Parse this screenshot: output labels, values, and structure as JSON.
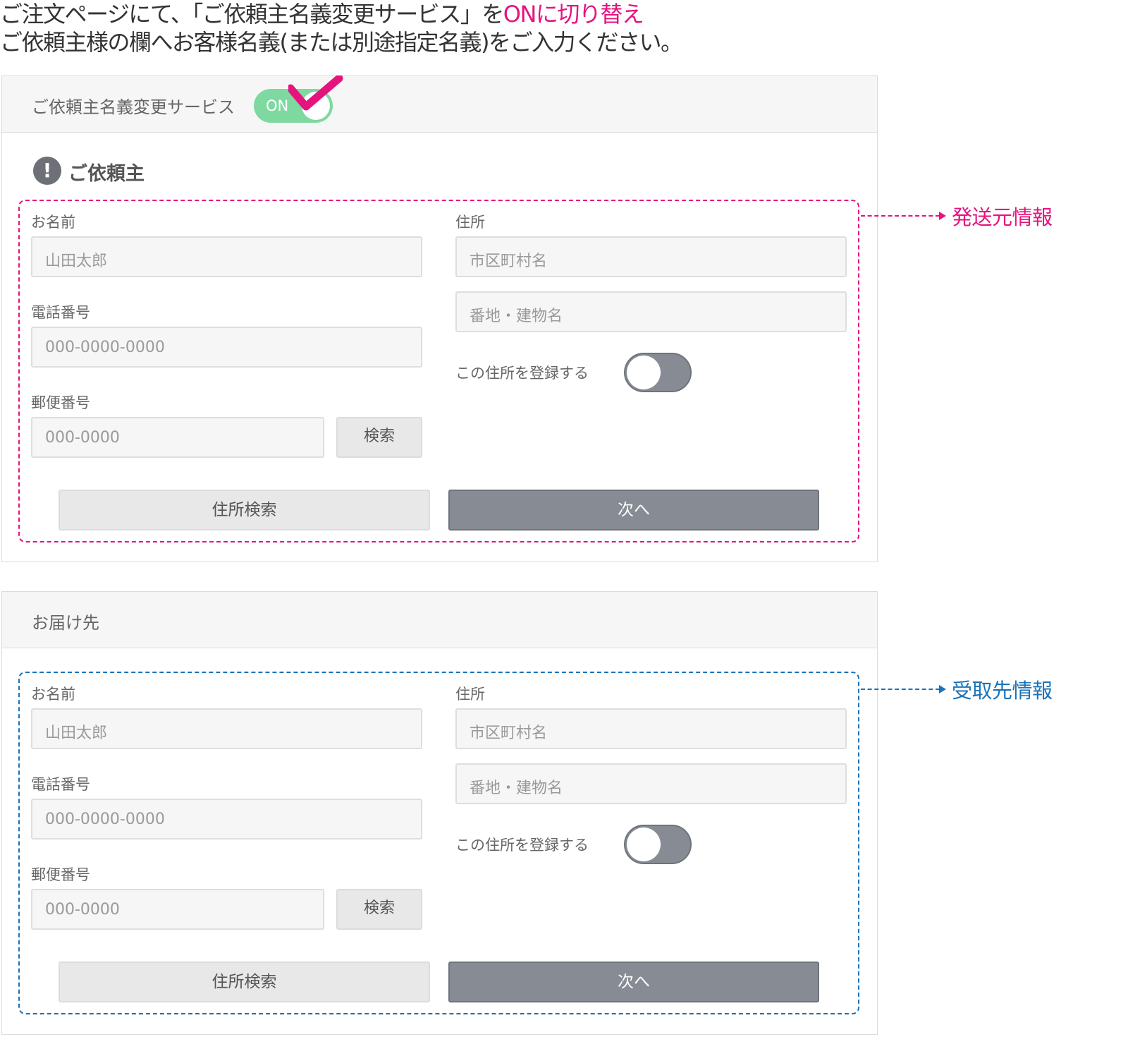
{
  "instructions": {
    "line1_part1": "ご注文ページにて、「ご依頼主名義変更サービス」を",
    "line1_highlight": "ONに切り替え",
    "line2": "ご依頼主様の欄へお客様名義(または別途指定名義)をご入力ください。"
  },
  "service_panel": {
    "title": "ご依頼主名義変更サービス",
    "toggle_label": "ON",
    "toggle_state": "on"
  },
  "sender_section": {
    "heading_icon": "!",
    "heading": "ご依頼主",
    "side_label": "発送元情報",
    "name_label": "お名前",
    "name_placeholder": "山田太郎",
    "phone_label": "電話番号",
    "phone_placeholder": "000-0000-0000",
    "zip_label": "郵便番号",
    "zip_placeholder": "000-0000",
    "search_label": "検索",
    "address_label": "住所",
    "city_placeholder": "市区町村名",
    "street_placeholder": "番地・建物名",
    "register_label": "この住所を登録する",
    "register_state": "off",
    "address_search_button": "住所検索",
    "next_button": "次へ"
  },
  "recipient_panel": {
    "title": "お届け先",
    "side_label": "受取先情報",
    "name_label": "お名前",
    "name_placeholder": "山田太郎",
    "phone_label": "電話番号",
    "phone_placeholder": "000-0000-0000",
    "zip_label": "郵便番号",
    "zip_placeholder": "000-0000",
    "search_label": "検索",
    "address_label": "住所",
    "city_placeholder": "市区町村名",
    "street_placeholder": "番地・建物名",
    "register_label": "この住所を登録する",
    "register_state": "off",
    "address_search_button": "住所検索",
    "next_button": "次へ"
  },
  "colors": {
    "accent_pink": "#e6137f",
    "accent_blue": "#1b73b8",
    "toggle_on": "#7ed9a0",
    "button_dark": "#878b93"
  },
  "icons": {
    "check": "check-icon",
    "alert": "exclamation-icon",
    "arrow": "arrow-right-icon"
  }
}
